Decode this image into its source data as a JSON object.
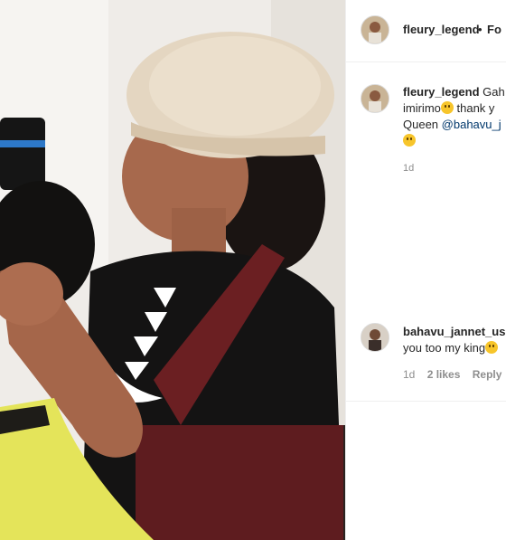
{
  "post": {
    "username": "fleury_legend",
    "separator": "•",
    "follow_label": "Fo"
  },
  "caption": {
    "username": "fleury_legend",
    "line1": "Gah",
    "line2_a": "imirimo",
    "line2_b": " thank y",
    "line3_a": "Queen ",
    "mention": "@bahavu_j",
    "time": "1d"
  },
  "comment": {
    "username": "bahavu_jannet_us",
    "text": "you too my king",
    "time": "1d",
    "likes": "2 likes",
    "reply_label": "Reply"
  },
  "icons": {
    "grin_emoji": "grinning-sweat-emoji",
    "kiss_emoji": "kissing-face-emoji",
    "smile_emoji": "smile-emoji"
  },
  "colors": {
    "text": "#262626",
    "secondary": "#8e8e8e",
    "mention": "#00376b",
    "border": "#efefef"
  }
}
